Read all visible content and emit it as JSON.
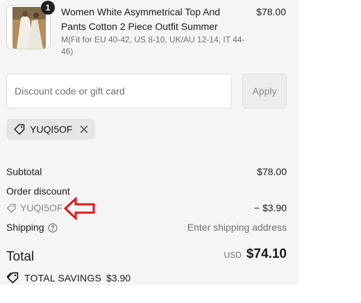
{
  "product": {
    "quantity": "1",
    "title": "Women White Asymmetrical Top And Pants Cotton 2 Piece Outfit Summer",
    "variant": "M(Fit for EU 40-42, US 8-10, UK/AU 12-14, IT 44-46)",
    "price": "$78.00",
    "image_icon": "product-photo"
  },
  "discount": {
    "placeholder": "Discount code or gift card",
    "value": "",
    "apply_label": "Apply",
    "applied_code": "YUQI5OF",
    "tag_icon": "tag-icon",
    "remove_icon": "close-icon"
  },
  "summary": {
    "subtotal_label": "Subtotal",
    "subtotal_value": "$78.00",
    "order_discount_label": "Order discount",
    "discount_code": "YUQI5OF",
    "discount_value": "− $3.90",
    "shipping_label": "Shipping",
    "shipping_value": "Enter shipping address",
    "help_icon": "question-circle-icon"
  },
  "total": {
    "label": "Total",
    "currency": "USD",
    "amount": "$74.10"
  },
  "savings": {
    "label": "TOTAL SAVINGS",
    "value": "$3.90",
    "icon": "tag-icon"
  },
  "colors": {
    "panel_bg": "#f5f5f5",
    "text": "#1a1a1a",
    "muted": "#707070",
    "annotation_arrow": "#e0161b"
  }
}
